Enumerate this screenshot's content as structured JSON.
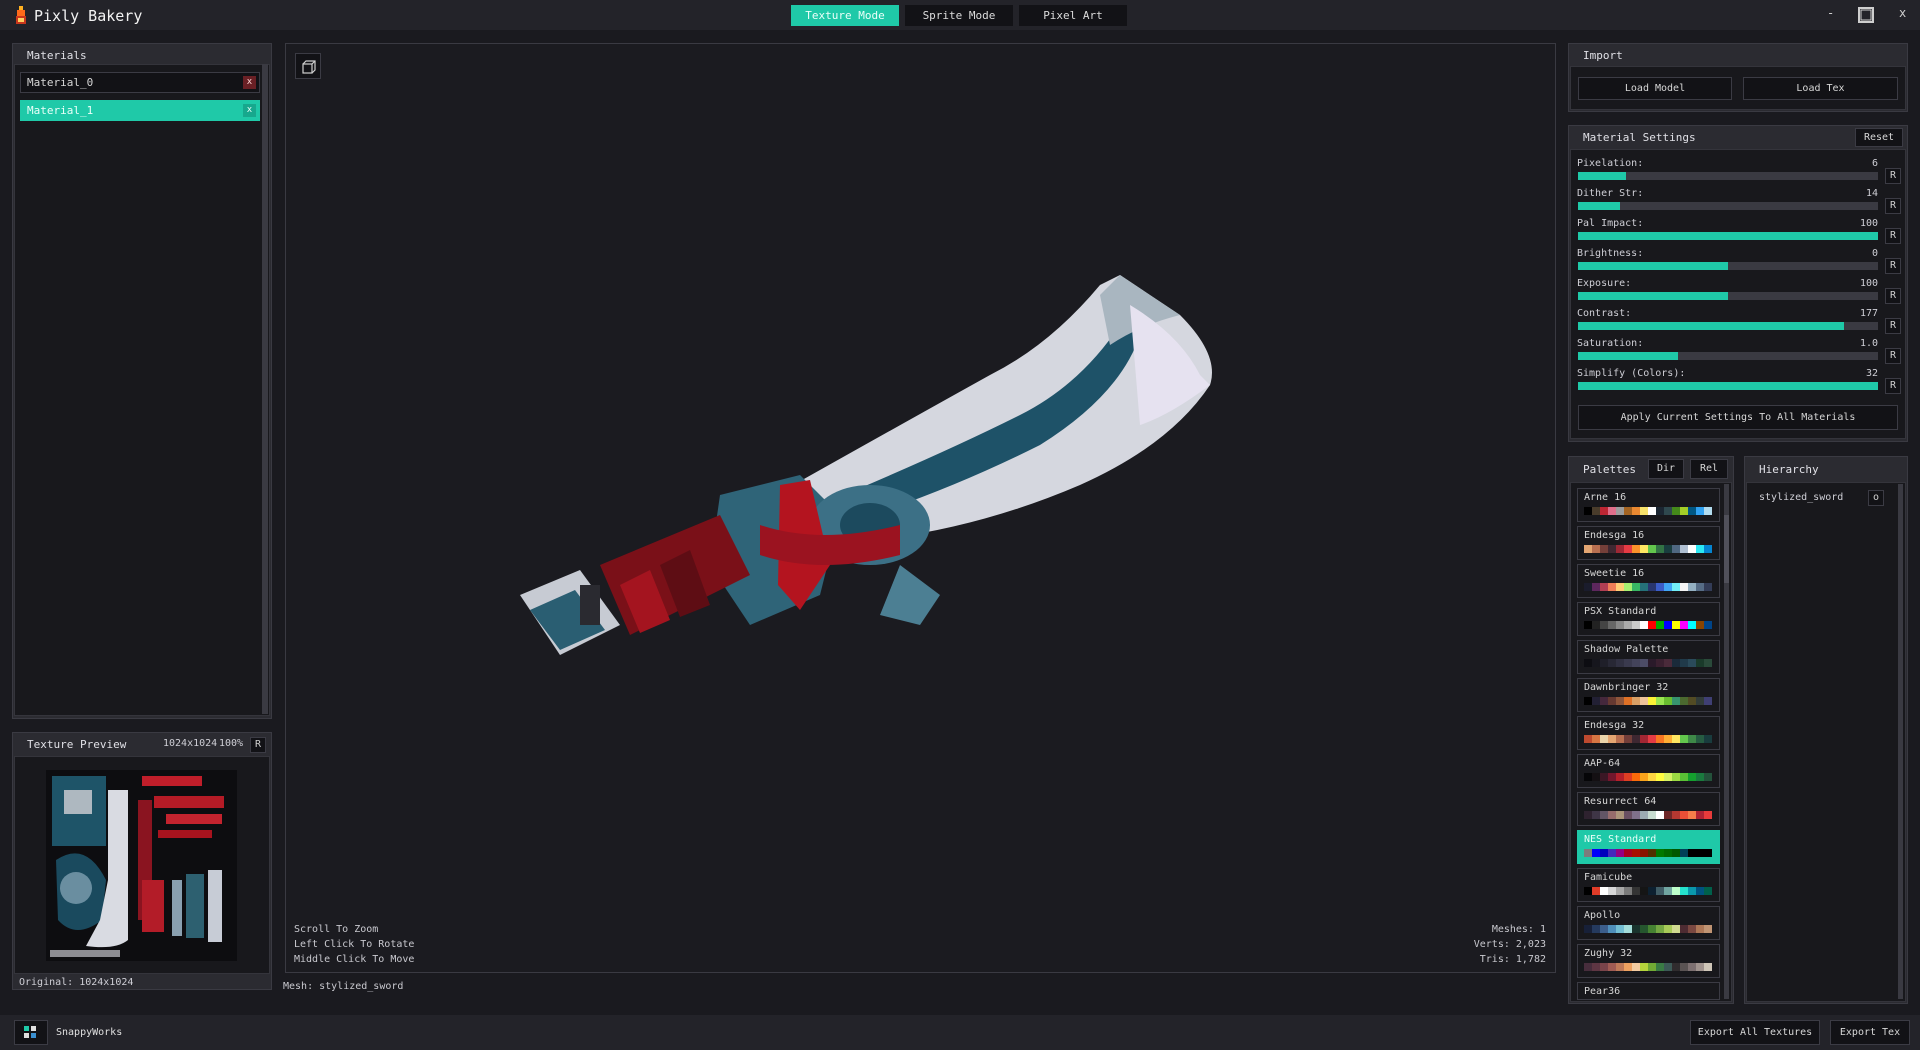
{
  "app": {
    "title": "Pixly Bakery"
  },
  "modes": [
    "Texture Mode",
    "Sprite Mode",
    "Pixel Art"
  ],
  "window_controls": {
    "minimize": "-",
    "close": "x"
  },
  "materials": {
    "title": "Materials",
    "items": [
      {
        "name": "Material_0",
        "active": false
      },
      {
        "name": "Material_1",
        "active": true
      }
    ],
    "remove_label": "x"
  },
  "texture_preview": {
    "title": "Texture Preview",
    "size": "1024x1024",
    "zoom": "100%",
    "reset_label": "R",
    "original": "Original: 1024x1024"
  },
  "viewport": {
    "hints": [
      "Scroll To Zoom",
      "Left Click To Rotate",
      "Middle Click To Move"
    ],
    "stats": [
      "Meshes: 1",
      "Verts: 2,023",
      "Tris: 1,782"
    ],
    "mesh_label": "Mesh: stylized_sword"
  },
  "import": {
    "title": "Import",
    "load_model": "Load Model",
    "load_tex": "Load Tex"
  },
  "material_settings": {
    "title": "Material Settings",
    "reset": "Reset",
    "reset_short": "R",
    "sliders": [
      {
        "label": "Pixelation:",
        "value": "6",
        "fill": 0.16
      },
      {
        "label": "Dither Str:",
        "value": "14",
        "fill": 0.14
      },
      {
        "label": "Pal Impact:",
        "value": "100",
        "fill": 1.0
      },
      {
        "label": "Brightness:",
        "value": "0",
        "fill": 0.5
      },
      {
        "label": "Exposure:",
        "value": "100",
        "fill": 0.5
      },
      {
        "label": "Contrast:",
        "value": "177",
        "fill": 0.885
      },
      {
        "label": "Saturation:",
        "value": "1.0",
        "fill": 0.333
      },
      {
        "label": "Simplify (Colors):",
        "value": "32",
        "fill": 1.0
      }
    ],
    "apply_all": "Apply Current Settings To All Materials"
  },
  "palettes": {
    "title": "Palettes",
    "dir": "Dir",
    "rel": "Rel",
    "items": [
      {
        "name": "Arne 16",
        "colors": [
          "#000000",
          "#493c2b",
          "#be2633",
          "#e06f8b",
          "#9d9d9d",
          "#a46422",
          "#eb8931",
          "#f7e26b",
          "#ffffff",
          "#1b2632",
          "#2f484e",
          "#44891a",
          "#a3ce27",
          "#005784",
          "#31a2f2",
          "#b2dcef"
        ]
      },
      {
        "name": "Endesga 16",
        "colors": [
          "#e4a672",
          "#b86f50",
          "#743f39",
          "#3f2832",
          "#9e2835",
          "#e53b44",
          "#fb922b",
          "#ffe762",
          "#63c64d",
          "#327345",
          "#193d3f",
          "#4f6781",
          "#afbfd2",
          "#ffffff",
          "#2ce8f4",
          "#0484d1"
        ]
      },
      {
        "name": "Sweetie 16",
        "colors": [
          "#1a1c2c",
          "#5d275d",
          "#b13e53",
          "#ef7d57",
          "#ffcd75",
          "#a7f070",
          "#38b764",
          "#257179",
          "#29366f",
          "#3b5dc9",
          "#41a6f6",
          "#73eff7",
          "#f4f4f4",
          "#94b0c2",
          "#566c86",
          "#333c57"
        ]
      },
      {
        "name": "PSX Standard",
        "colors": [
          "#000000",
          "#222222",
          "#444444",
          "#666666",
          "#888888",
          "#aaaaaa",
          "#cccccc",
          "#ffffff",
          "#ff0000",
          "#00aa00",
          "#0000ff",
          "#ffff00",
          "#ff00ff",
          "#00ffff",
          "#884400",
          "#004488"
        ]
      },
      {
        "name": "Shadow Palette",
        "colors": [
          "#0d0d12",
          "#16161d",
          "#1f1f29",
          "#282835",
          "#313142",
          "#3a3a4e",
          "#43435a",
          "#4c4c66",
          "#2a1a2a",
          "#3a2030",
          "#4a2a3a",
          "#1a2a3a",
          "#203a4a",
          "#2a4a5a",
          "#1a3a2a",
          "#2a4a3a"
        ]
      },
      {
        "name": "Dawnbringer 32",
        "colors": [
          "#000000",
          "#222034",
          "#45283c",
          "#663931",
          "#8f563b",
          "#df7126",
          "#d9a066",
          "#eec39a",
          "#fbf236",
          "#99e550",
          "#6abe30",
          "#37946e",
          "#4b692f",
          "#524b24",
          "#323c39",
          "#3f3f74"
        ]
      },
      {
        "name": "Endesga 32",
        "colors": [
          "#be4a2f",
          "#d77643",
          "#ead4aa",
          "#e4a672",
          "#b86f50",
          "#733e39",
          "#3e2731",
          "#a22633",
          "#e43b44",
          "#f77622",
          "#feae34",
          "#fee761",
          "#63c74d",
          "#3e8948",
          "#265c42",
          "#193c3e"
        ]
      },
      {
        "name": "AAP-64",
        "colors": [
          "#060608",
          "#141013",
          "#3b1725",
          "#73172d",
          "#b4202a",
          "#df3e23",
          "#fa6a0a",
          "#f9a31b",
          "#ffd541",
          "#fffc40",
          "#d6f264",
          "#9cdb43",
          "#59c135",
          "#14a02e",
          "#1a7a3e",
          "#24523b"
        ]
      },
      {
        "name": "Resurrect 64",
        "colors": [
          "#2e222f",
          "#3e3546",
          "#625565",
          "#966c6c",
          "#ab947a",
          "#694f62",
          "#7f708a",
          "#9babb2",
          "#c7dcd0",
          "#ffffff",
          "#6e2727",
          "#b33831",
          "#ea4f36",
          "#f57d4a",
          "#ae2334",
          "#e83b3b"
        ]
      },
      {
        "name": "NES Standard",
        "colors": [
          "#7c7c7c",
          "#0000fc",
          "#0000bc",
          "#4428bc",
          "#940084",
          "#a80020",
          "#a81000",
          "#881400",
          "#503000",
          "#007800",
          "#006800",
          "#005800",
          "#004058",
          "#000000",
          "#000000",
          "#000000"
        ]
      },
      {
        "name": "Famicube",
        "colors": [
          "#000000",
          "#e03c28",
          "#ffffff",
          "#d7d7d7",
          "#a8a8a8",
          "#7b7b7b",
          "#343434",
          "#151515",
          "#0d2030",
          "#415d66",
          "#71a6a1",
          "#bdffca",
          "#25e2cd",
          "#0a98ac",
          "#005280",
          "#00604b"
        ]
      },
      {
        "name": "Apollo",
        "colors": [
          "#172038",
          "#253a5e",
          "#3c5e8b",
          "#4f8fba",
          "#73bed3",
          "#a4dddb",
          "#19332d",
          "#25562e",
          "#468232",
          "#75a743",
          "#a8ca58",
          "#d0da91",
          "#4d2b32",
          "#7a4841",
          "#ad7757",
          "#c09473"
        ]
      },
      {
        "name": "Zughy 32",
        "colors": [
          "#472d3c",
          "#5e3643",
          "#7a444a",
          "#a05b53",
          "#bf7958",
          "#eea160",
          "#f4cca1",
          "#b6d53c",
          "#71aa34",
          "#397b44",
          "#3c5956",
          "#302c2e",
          "#5a5353",
          "#7d7071",
          "#a0938e",
          "#cfc6b8"
        ]
      },
      {
        "name": "Pear36",
        "colors": []
      }
    ],
    "active_index": 9
  },
  "hierarchy": {
    "title": "Hierarchy",
    "items": [
      {
        "name": "stylized_sword",
        "toggle": "o"
      }
    ]
  },
  "footer": {
    "company": "SnappyWorks",
    "export_all": "Export All Textures",
    "export_tex": "Export Tex"
  },
  "colors": {
    "accent": "#1fc9a8",
    "panel": "#2b2b31",
    "background": "#1a1a1f",
    "danger": "#6a2025"
  }
}
